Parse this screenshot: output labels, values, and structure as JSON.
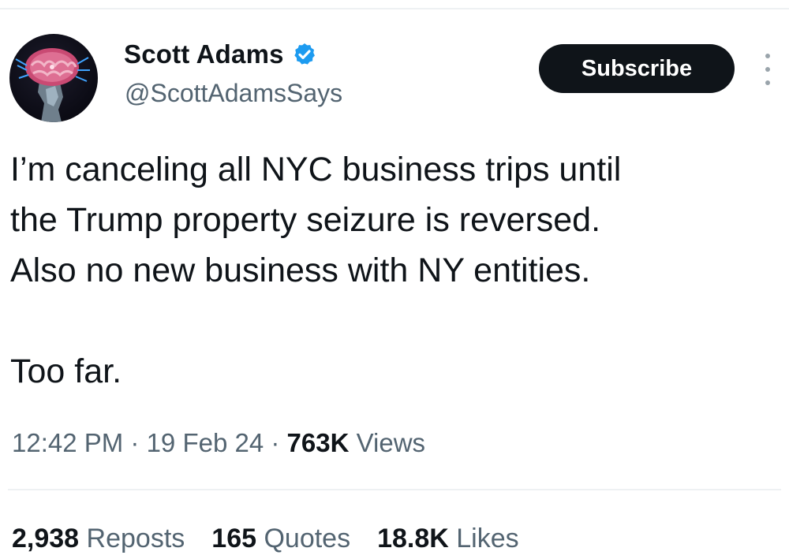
{
  "author": {
    "name": "Scott Adams",
    "handle": "@ScottAdamsSays",
    "verified_color": "#1d9bf0"
  },
  "actions": {
    "subscribe_label": "Subscribe",
    "more_icon": "more-vertical-icon"
  },
  "tweet": {
    "lines": [
      "I’m canceling all NYC business trips until",
      "the Trump property seizure is reversed.",
      "Also no new business with NY entities."
    ],
    "closing": "Too far."
  },
  "meta": {
    "time": "12:42 PM",
    "sep1": " · ",
    "date": "19 Feb 24",
    "sep2": " · ",
    "views_count": "763K",
    "views_label": " Views"
  },
  "stats": {
    "reposts_count": "2,938",
    "reposts_label": " Reposts",
    "quotes_count": "165",
    "quotes_label": " Quotes",
    "likes_count": "18.8K",
    "likes_label": " Likes"
  },
  "colors": {
    "text_primary": "#0f1419",
    "text_secondary": "#536471",
    "button_bg": "#0f1419"
  }
}
